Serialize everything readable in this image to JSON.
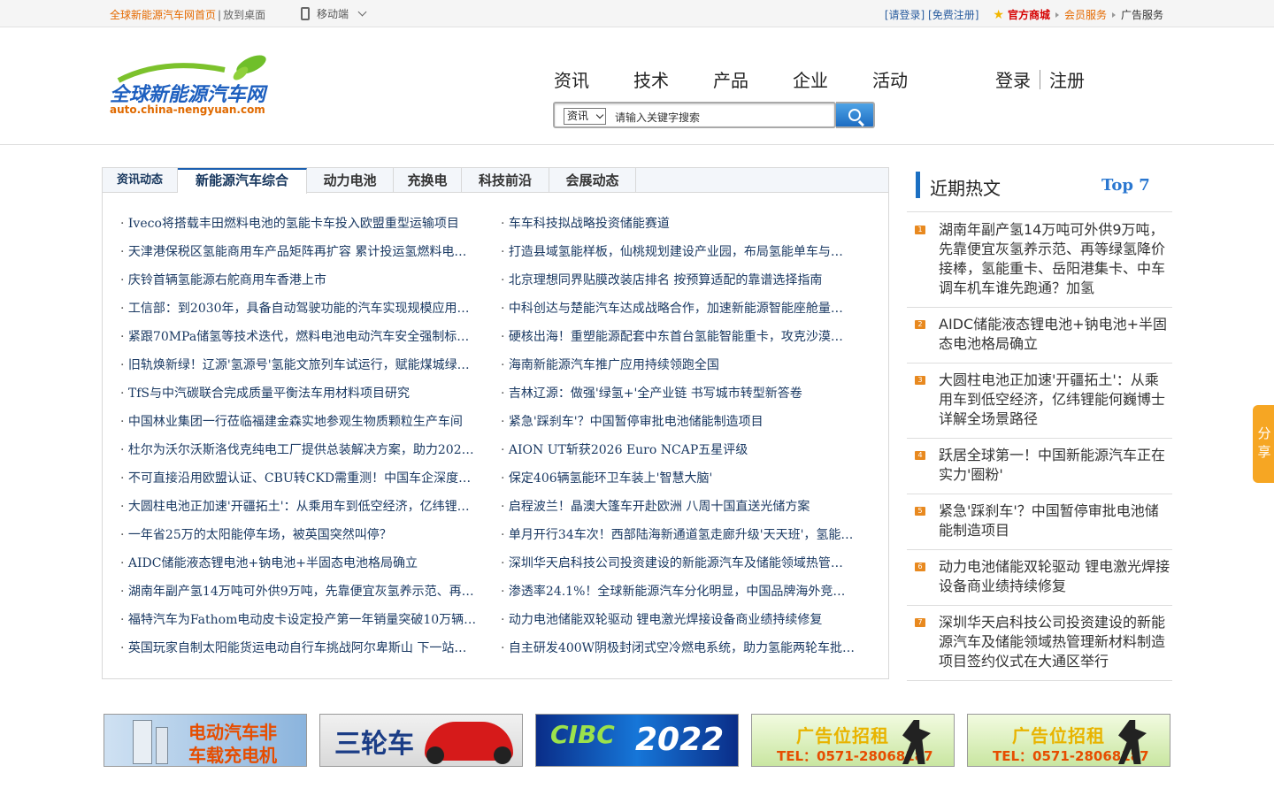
{
  "topbar": {
    "home_link": "全球新能源汽车网首页",
    "separator": "|",
    "desktop_link": "放到桌面",
    "mobile_label": "移动端",
    "login_link": "[请登录]",
    "register_link": "[免费注册]",
    "shop_link": "官方商城",
    "member_link": "会员服务",
    "ad_link": "广告服务"
  },
  "logo": {
    "name": "全球新能源汽车网",
    "url": "auto.china-nengyuan.com"
  },
  "nav": {
    "items": [
      "资讯",
      "技术",
      "产品",
      "企业",
      "活动"
    ],
    "login": "登录",
    "register": "注册"
  },
  "search": {
    "category": "资讯",
    "placeholder": "请输入关键字搜索"
  },
  "news_panel": {
    "tabs": [
      "资讯动态",
      "新能源汽车综合",
      "动力电池",
      "充换电",
      "科技前沿",
      "会展动态"
    ],
    "active_tab": "新能源汽车综合",
    "left_column": [
      "Iveco将搭载丰田燃料电池的氢能卡车投入欧盟重型运输项目",
      "天津港保税区氢能商用车产品矩阵再扩容 累计投运氢燃料电…",
      "庆铃首辆氢能源右舵商用车香港上市",
      "工信部：到2030年，具备自动驾驶功能的汽车实现规模应用…",
      "紧跟70MPa储氢等技术迭代，燃料电池电动汽车安全强制标…",
      "旧轨焕新绿！辽源'氢源号'氢能文旅列车试运行，赋能煤城绿…",
      "TfS与中汽碳联合完成质量平衡法车用材料项目研究",
      "中国林业集团一行莅临福建金森实地参观生物质颗粒生产车间",
      "杜尔为沃尔沃斯洛伐克纯电工厂提供总装解决方案，助力202…",
      "不可直接沿用欧盟认证、CBU转CKD需重测！中国车企深度…",
      "大圆柱电池正加速'开疆拓土'：从乘用车到低空经济，亿纬锂…",
      "一年省25万的太阳能停车场，被英国突然叫停？",
      "AIDC储能液态锂电池+钠电池+半固态电池格局确立",
      "湖南年副产氢14万吨可外供9万吨，先靠便宜灰氢养示范、再…",
      "福特汽车为Fathom电动皮卡设定投产第一年销量突破10万辆…",
      "英国玩家自制太阳能货运电动自行车挑战阿尔卑斯山 下一站…"
    ],
    "right_column": [
      "车车科技拟战略投资储能赛道",
      "打造县域氢能样板，仙桃规划建设产业园，布局氢能单车与…",
      "北京理想同界贴膜改装店排名 按预算适配的靠谱选择指南",
      "中科创达与楚能汽车达成战略合作，加速新能源智能座舱量…",
      "硬核出海！重塑能源配套中东首台氢能智能重卡，攻克沙漠…",
      "海南新能源汽车推广应用持续领跑全国",
      "吉林辽源：做强'绿氢+'全产业链 书写城市转型新答卷",
      "紧急'踩刹车'？中国暂停审批电池储能制造项目",
      "AION UT斩获2026 Euro NCAP五星评级",
      "保定406辆氢能环卫车装上'智慧大脑'",
      "启程波兰！晶澳大篷车开赴欧洲 八周十国直送光储方案",
      "单月开行34车次！西部陆海新通道氢走廊升级'天天班'，氢能…",
      "深圳华天启科技公司投资建设的新能源汽车及储能领域热管…",
      "渗透率24.1%！全球新能源汽车分化明显，中国品牌海外竞…",
      "动力电池储能双轮驱动 锂电激光焊接设备商业绩持续修复",
      "自主研发400W阴极封闭式空冷燃电系统，助力氢能两轮车批…"
    ]
  },
  "hot": {
    "title": "近期热文",
    "badge": "Top 7",
    "items": [
      {
        "num": "1",
        "text": "湖南年副产氢14万吨可外供9万吨，先靠便宜灰氢养示范、再等绿氢降价接棒，氢能重卡、岳阳港集卡、中车调车机车谁先跑通？加氢"
      },
      {
        "num": "2",
        "text": "AIDC储能液态锂电池+钠电池+半固态电池格局确立"
      },
      {
        "num": "3",
        "text": "大圆柱电池正加速'开疆拓土'：从乘用车到低空经济，亿纬锂能何巍博士详解全场景路径"
      },
      {
        "num": "4",
        "text": "跃居全球第一！中国新能源汽车正在实力'圈粉'"
      },
      {
        "num": "5",
        "text": "紧急'踩刹车'？中国暂停审批电池储能制造项目"
      },
      {
        "num": "6",
        "text": "动力电池储能双轮驱动 锂电激光焊接设备商业绩持续修复"
      },
      {
        "num": "7",
        "text": "深圳华天启科技公司投资建设的新能源汽车及储能领域热管理新材料制造项目签约仪式在大通区举行"
      }
    ]
  },
  "share": {
    "label_1": "分",
    "label_2": "享"
  },
  "banners": {
    "b1_line1": "电动汽车非",
    "b1_line2": "车载充电机",
    "b2_text": "三轮车",
    "b3_text1": "CIBC",
    "b3_text2": "2022",
    "b4_title": "广告位招租",
    "b4_tel": "TEL：0571-28068187",
    "b5_title": "广告位招租",
    "b5_tel": "TEL：0571-28068187"
  },
  "colors": {
    "accent_blue": "#1b6fc2",
    "link_blue": "#1b3a63",
    "orange": "#e56a00",
    "red": "#d60000"
  }
}
